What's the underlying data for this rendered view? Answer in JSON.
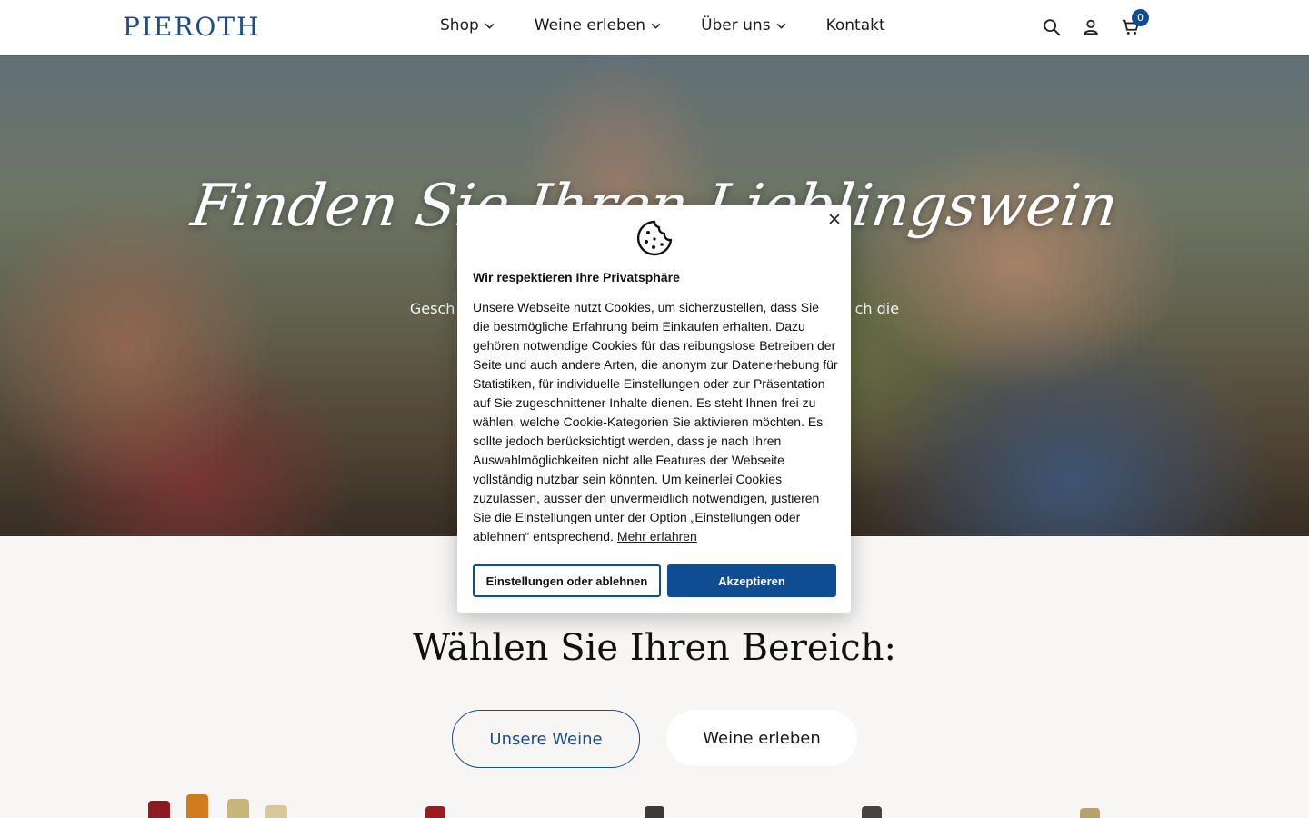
{
  "header": {
    "logo": "PIEROTH",
    "nav": [
      {
        "label": "Shop"
      },
      {
        "label": "Weine erleben"
      },
      {
        "label": "Über uns"
      },
      {
        "label": "Kontakt"
      }
    ],
    "cart_count": "0",
    "icons": [
      "search-icon",
      "user-icon",
      "cart-icon"
    ]
  },
  "hero": {
    "title": "Finden Sie Ihren Lieblingswein",
    "subtitle_left": "Gesch",
    "subtitle_right": "ch die"
  },
  "section": {
    "title": "Wählen Sie Ihren Bereich:",
    "buttons": [
      {
        "label": "Unsere Weine"
      },
      {
        "label": "Weine erleben"
      }
    ]
  },
  "cookie": {
    "title": "Wir respektieren Ihre Privatsphäre",
    "text": "Unsere Webseite nutzt Cookies, um sicherzustellen, dass Sie die bestmögliche Erfahrung beim Einkaufen erhalten. Dazu gehören notwendige Cookies für das reibungslose Betreiben der Seite und auch andere Arten, die anonym zur Datenerhebung für Statistiken, für individuelle Einstellungen oder zur Präsentation auf Sie zugeschnittener Inhalte dienen. Es steht Ihnen frei zu wählen, welche Cookie-Kategorien Sie aktivieren möchten. Es sollte jedoch berücksichtigt werden, dass je nach Ihren Auswahlmöglichkeiten nicht alle Features der Webseite vollständig nutzbar sein könnten. Um keinerlei Cookies zuzulassen, ausser den unvermeidlich notwendigen, justieren Sie die Einstellungen unter der Option „Einstellungen oder ablehnen“ entsprechend.",
    "link": "Mehr erfahren",
    "btn_settings": "Einstellungen oder ablehnen",
    "btn_accept": "Akzeptieren"
  },
  "colors": {
    "brand": "#1d4c86",
    "accent": "#0f4c92"
  }
}
